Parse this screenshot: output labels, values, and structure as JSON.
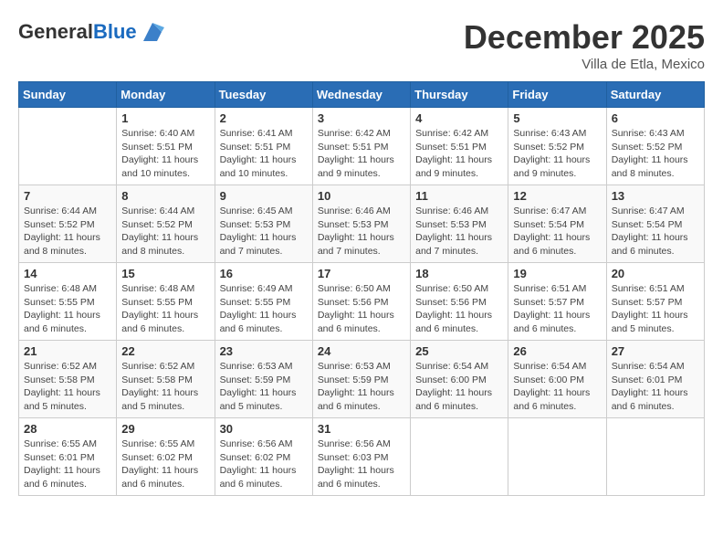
{
  "header": {
    "logo_general": "General",
    "logo_blue": "Blue",
    "month_title": "December 2025",
    "location": "Villa de Etla, Mexico"
  },
  "weekdays": [
    "Sunday",
    "Monday",
    "Tuesday",
    "Wednesday",
    "Thursday",
    "Friday",
    "Saturday"
  ],
  "weeks": [
    [
      {
        "day": "",
        "info": ""
      },
      {
        "day": "1",
        "info": "Sunrise: 6:40 AM\nSunset: 5:51 PM\nDaylight: 11 hours\nand 10 minutes."
      },
      {
        "day": "2",
        "info": "Sunrise: 6:41 AM\nSunset: 5:51 PM\nDaylight: 11 hours\nand 10 minutes."
      },
      {
        "day": "3",
        "info": "Sunrise: 6:42 AM\nSunset: 5:51 PM\nDaylight: 11 hours\nand 9 minutes."
      },
      {
        "day": "4",
        "info": "Sunrise: 6:42 AM\nSunset: 5:51 PM\nDaylight: 11 hours\nand 9 minutes."
      },
      {
        "day": "5",
        "info": "Sunrise: 6:43 AM\nSunset: 5:52 PM\nDaylight: 11 hours\nand 9 minutes."
      },
      {
        "day": "6",
        "info": "Sunrise: 6:43 AM\nSunset: 5:52 PM\nDaylight: 11 hours\nand 8 minutes."
      }
    ],
    [
      {
        "day": "7",
        "info": "Sunrise: 6:44 AM\nSunset: 5:52 PM\nDaylight: 11 hours\nand 8 minutes."
      },
      {
        "day": "8",
        "info": "Sunrise: 6:44 AM\nSunset: 5:52 PM\nDaylight: 11 hours\nand 8 minutes."
      },
      {
        "day": "9",
        "info": "Sunrise: 6:45 AM\nSunset: 5:53 PM\nDaylight: 11 hours\nand 7 minutes."
      },
      {
        "day": "10",
        "info": "Sunrise: 6:46 AM\nSunset: 5:53 PM\nDaylight: 11 hours\nand 7 minutes."
      },
      {
        "day": "11",
        "info": "Sunrise: 6:46 AM\nSunset: 5:53 PM\nDaylight: 11 hours\nand 7 minutes."
      },
      {
        "day": "12",
        "info": "Sunrise: 6:47 AM\nSunset: 5:54 PM\nDaylight: 11 hours\nand 6 minutes."
      },
      {
        "day": "13",
        "info": "Sunrise: 6:47 AM\nSunset: 5:54 PM\nDaylight: 11 hours\nand 6 minutes."
      }
    ],
    [
      {
        "day": "14",
        "info": "Sunrise: 6:48 AM\nSunset: 5:55 PM\nDaylight: 11 hours\nand 6 minutes."
      },
      {
        "day": "15",
        "info": "Sunrise: 6:48 AM\nSunset: 5:55 PM\nDaylight: 11 hours\nand 6 minutes."
      },
      {
        "day": "16",
        "info": "Sunrise: 6:49 AM\nSunset: 5:55 PM\nDaylight: 11 hours\nand 6 minutes."
      },
      {
        "day": "17",
        "info": "Sunrise: 6:50 AM\nSunset: 5:56 PM\nDaylight: 11 hours\nand 6 minutes."
      },
      {
        "day": "18",
        "info": "Sunrise: 6:50 AM\nSunset: 5:56 PM\nDaylight: 11 hours\nand 6 minutes."
      },
      {
        "day": "19",
        "info": "Sunrise: 6:51 AM\nSunset: 5:57 PM\nDaylight: 11 hours\nand 6 minutes."
      },
      {
        "day": "20",
        "info": "Sunrise: 6:51 AM\nSunset: 5:57 PM\nDaylight: 11 hours\nand 5 minutes."
      }
    ],
    [
      {
        "day": "21",
        "info": "Sunrise: 6:52 AM\nSunset: 5:58 PM\nDaylight: 11 hours\nand 5 minutes."
      },
      {
        "day": "22",
        "info": "Sunrise: 6:52 AM\nSunset: 5:58 PM\nDaylight: 11 hours\nand 5 minutes."
      },
      {
        "day": "23",
        "info": "Sunrise: 6:53 AM\nSunset: 5:59 PM\nDaylight: 11 hours\nand 5 minutes."
      },
      {
        "day": "24",
        "info": "Sunrise: 6:53 AM\nSunset: 5:59 PM\nDaylight: 11 hours\nand 6 minutes."
      },
      {
        "day": "25",
        "info": "Sunrise: 6:54 AM\nSunset: 6:00 PM\nDaylight: 11 hours\nand 6 minutes."
      },
      {
        "day": "26",
        "info": "Sunrise: 6:54 AM\nSunset: 6:00 PM\nDaylight: 11 hours\nand 6 minutes."
      },
      {
        "day": "27",
        "info": "Sunrise: 6:54 AM\nSunset: 6:01 PM\nDaylight: 11 hours\nand 6 minutes."
      }
    ],
    [
      {
        "day": "28",
        "info": "Sunrise: 6:55 AM\nSunset: 6:01 PM\nDaylight: 11 hours\nand 6 minutes."
      },
      {
        "day": "29",
        "info": "Sunrise: 6:55 AM\nSunset: 6:02 PM\nDaylight: 11 hours\nand 6 minutes."
      },
      {
        "day": "30",
        "info": "Sunrise: 6:56 AM\nSunset: 6:02 PM\nDaylight: 11 hours\nand 6 minutes."
      },
      {
        "day": "31",
        "info": "Sunrise: 6:56 AM\nSunset: 6:03 PM\nDaylight: 11 hours\nand 6 minutes."
      },
      {
        "day": "",
        "info": ""
      },
      {
        "day": "",
        "info": ""
      },
      {
        "day": "",
        "info": ""
      }
    ]
  ]
}
